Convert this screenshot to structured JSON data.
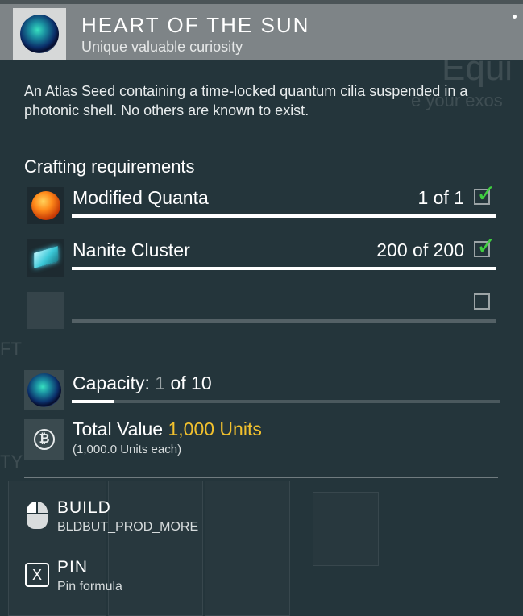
{
  "item": {
    "title": "HEART OF THE SUN",
    "subtitle": "Unique valuable curiosity",
    "icon": "heart-of-the-sun-orb-icon",
    "description": "An Atlas Seed containing a time-locked quantum cilia suspended in a photonic shell. No others are known to exist."
  },
  "crafting": {
    "title": "Crafting requirements",
    "requirements": [
      {
        "name": "Modified Quanta",
        "count": "1 of 1",
        "icon": "modified-quanta-icon",
        "met": true
      },
      {
        "name": "Nanite Cluster",
        "count": "200 of 200",
        "icon": "nanite-cluster-icon",
        "met": true
      },
      {
        "name": "",
        "count": "",
        "icon": "empty-slot",
        "met": false
      }
    ]
  },
  "capacity": {
    "label": "Capacity:",
    "current": "1",
    "of_text": "of 10",
    "fill_fraction": 0.1
  },
  "value": {
    "label": "Total Value",
    "amount": "1,000 Units",
    "each": "(1,000.0 Units each)",
    "icon": "units-icon"
  },
  "actions": [
    {
      "title": "BUILD",
      "subtitle": "BLDBUT_PROD_MORE",
      "icon": "mouse-left-click-icon"
    },
    {
      "title": "PIN",
      "subtitle": "Pin formula",
      "icon": "x-key-icon",
      "key": "X"
    }
  ],
  "colors": {
    "accent_gold": "#f2c12e",
    "check_green": "#3fce3f",
    "panel_bg": "#24353b",
    "header_bg": "#7e8487"
  }
}
